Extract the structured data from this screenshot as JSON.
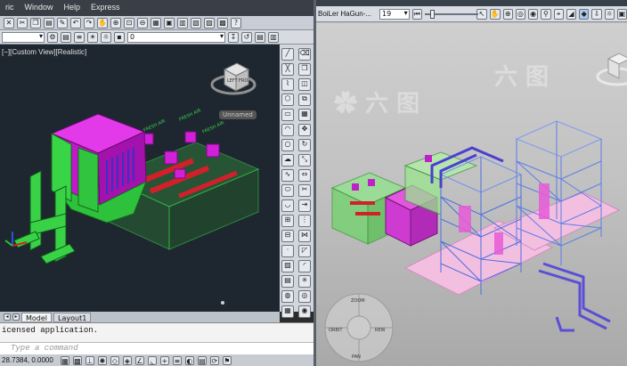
{
  "left_window": {
    "menu": [
      "ric",
      "Window",
      "Help",
      "Express"
    ],
    "layer_value": "0",
    "viewport_label": "[−][Custom View][Realistic]",
    "viewcube_label": "Unnamed",
    "tabs": [
      {
        "label": "Model",
        "active": true
      },
      {
        "label": "Layout1",
        "active": false
      }
    ],
    "command_history": "icensed application.",
    "command_placeholder": "Type a command",
    "coordinates": "28.7384, 0.0000",
    "annotations": [
      "FRESH AIR",
      "FRESH AIR",
      "FRESH AIR"
    ]
  },
  "right_window": {
    "project_title": "BoiLer HaGun-...",
    "frame_value": "19"
  },
  "colors": {
    "magenta": "#d020d8",
    "green": "#34d63c",
    "red_pipe": "#d2202a",
    "blue_steel": "#3f5ccf",
    "pink_slab": "#f3b9e3"
  }
}
